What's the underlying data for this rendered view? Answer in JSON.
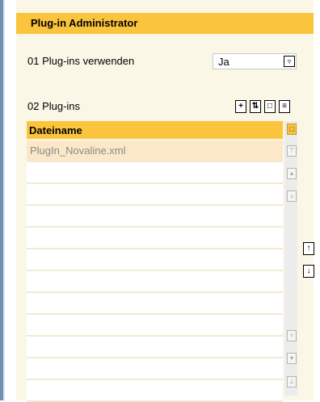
{
  "title": "Plug-in Administrator",
  "setting": {
    "label": "01 Plug-ins verwenden",
    "value": "Ja"
  },
  "plugins": {
    "label": "02 Plug-ins",
    "toolbar_icons": [
      "add-icon",
      "copy-icon",
      "delete-icon",
      "details-icon"
    ],
    "column_header": "Dateiname",
    "rows": [
      "PlugIn_Novaline.xml",
      "",
      "",
      "",
      "",
      "",
      "",
      "",
      "",
      "",
      "",
      ""
    ]
  },
  "side_buttons": [
    "move-up-icon",
    "move-down-icon"
  ],
  "colors": {
    "accent": "#fbc43d",
    "panel": "#fbf7e6",
    "selected_row": "#fbe8c8"
  }
}
